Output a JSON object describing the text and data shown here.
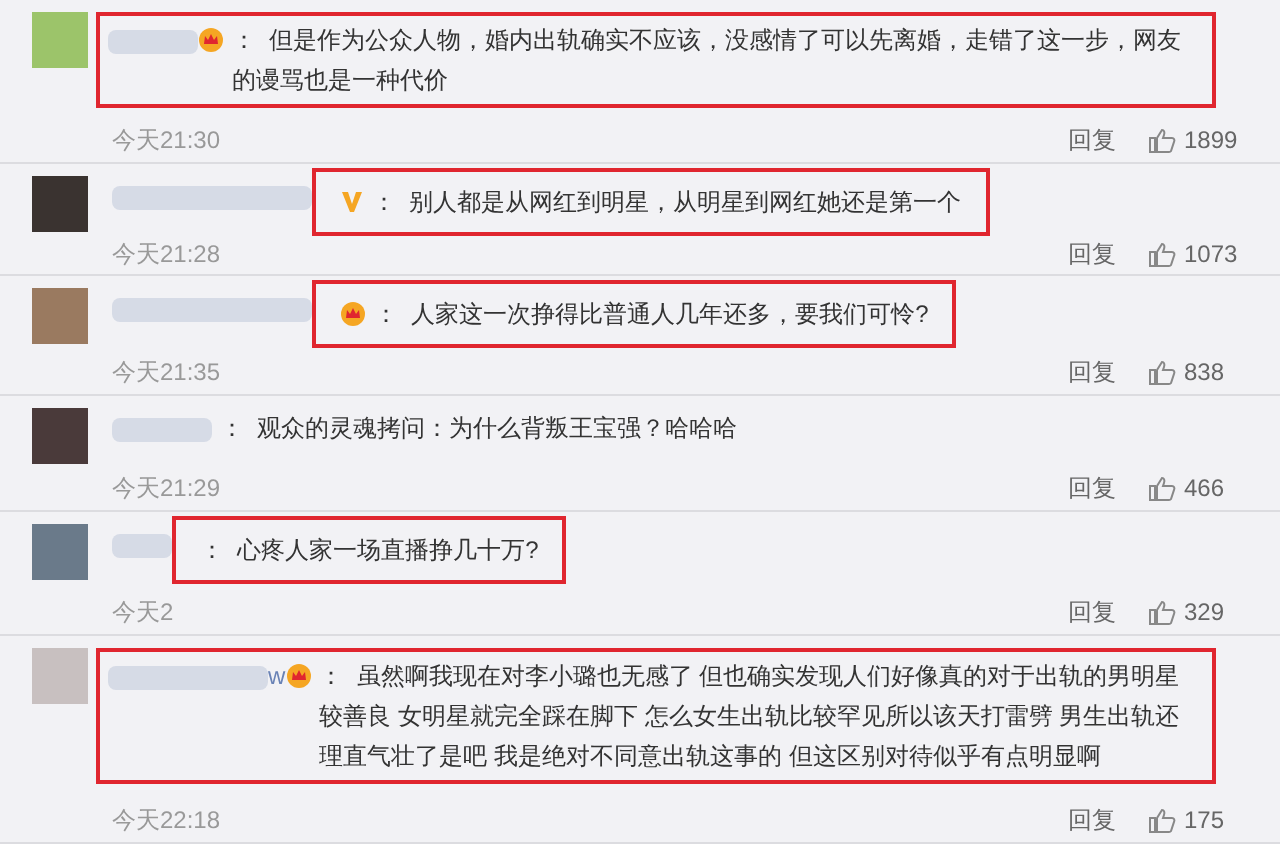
{
  "comments": [
    {
      "crown": true,
      "verified": false,
      "highlighted": true,
      "text": "：  但是作为公众人物，婚内出轨确实不应该，没感情了可以先离婚，走错了这一步，网友的谩骂也是一种代价",
      "time": "今天21:30",
      "reply": "回复",
      "likes": "1899"
    },
    {
      "crown": false,
      "verified": true,
      "highlighted": true,
      "text": "：  别人都是从网红到明星，从明星到网红她还是第一个",
      "time": "今天21:28",
      "reply": "回复",
      "likes": "1073"
    },
    {
      "crown": true,
      "verified": false,
      "highlighted": true,
      "text": "：  人家这一次挣得比普通人几年还多，要我们可怜?",
      "time": "今天21:35",
      "reply": "回复",
      "likes": "838"
    },
    {
      "crown": false,
      "verified": false,
      "highlighted": false,
      "text": "：  观众的灵魂拷问：为什么背叛王宝强？哈哈哈",
      "time": "今天21:29",
      "reply": "回复",
      "likes": "466"
    },
    {
      "crown": false,
      "verified": false,
      "highlighted": true,
      "text": "：  心疼人家一场直播挣几十万?",
      "time": "今天2",
      "reply": "回复",
      "likes": "329"
    },
    {
      "crown": true,
      "verified": false,
      "highlighted": true,
      "name_tail": "w",
      "text": "：  虽然啊我现在对李小璐也无感了 但也确实发现人们好像真的对于出轨的男明星较善良 女明星就完全踩在脚下 怎么女生出轨比较罕见所以该天打雷劈 男生出轨还理直气壮了是吧 我是绝对不同意出轨这事的 但这区别对待似乎有点明显啊",
      "time": "今天22:18",
      "reply": "回复",
      "likes": "175"
    }
  ]
}
